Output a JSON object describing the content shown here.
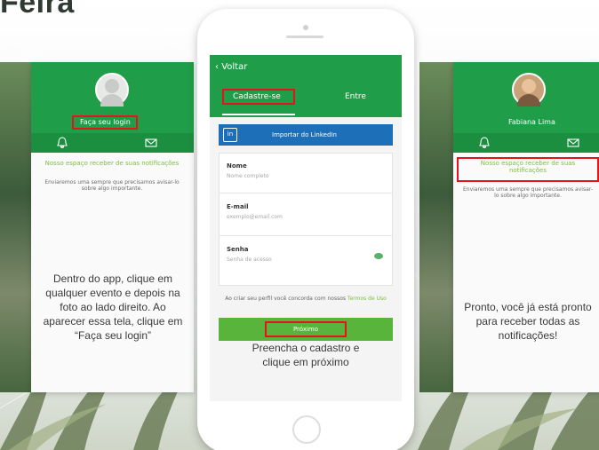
{
  "heading": "Feira",
  "colors": {
    "brand_green": "#1f9d48",
    "accent_green": "#7bbf3e",
    "highlight_red": "#e3141b",
    "linkedin_blue": "#1d6fb8"
  },
  "left": {
    "login_label": "Faça seu login",
    "notice": "Nosso espaço receber de suas notificações",
    "sub": "Enviaremos uma sempre que precisamos avisar-lo sobre algo importante.",
    "instruction": "Dentro do app, clique em qualquer evento e depois na foto ao lado direito. Ao aparecer essa tela, clique em “Faça seu login”"
  },
  "phone": {
    "back_label": "Voltar",
    "tabs": [
      "Cadastre-se",
      "Entre"
    ],
    "linkedin_label": "Importar do LinkedIn",
    "fields": [
      {
        "label": "Nome",
        "placeholder": "Nome completo"
      },
      {
        "label": "E-mail",
        "placeholder": "exemplo@email.com"
      },
      {
        "label": "Senha",
        "placeholder": "Senha de acesso"
      }
    ],
    "terms": "Ao criar seu perfil você concorda com nossos",
    "terms_link": "Termos de Uso",
    "next_label": "Próximo",
    "caption": "Preencha o cadastro e clique em próximo"
  },
  "right": {
    "profile_name": "Fabiana Lima",
    "notice": "Nosso espaço receber de suas notificações",
    "sub": "Enviaremos uma sempre que precisamos avisar-lo sobre algo importante.",
    "caption": "Pronto, você já está pronto para receber todas as notificações!"
  },
  "icons": [
    "bell-icon",
    "mail-icon",
    "linkedin-icon",
    "eye-icon",
    "chevron-left-icon"
  ]
}
